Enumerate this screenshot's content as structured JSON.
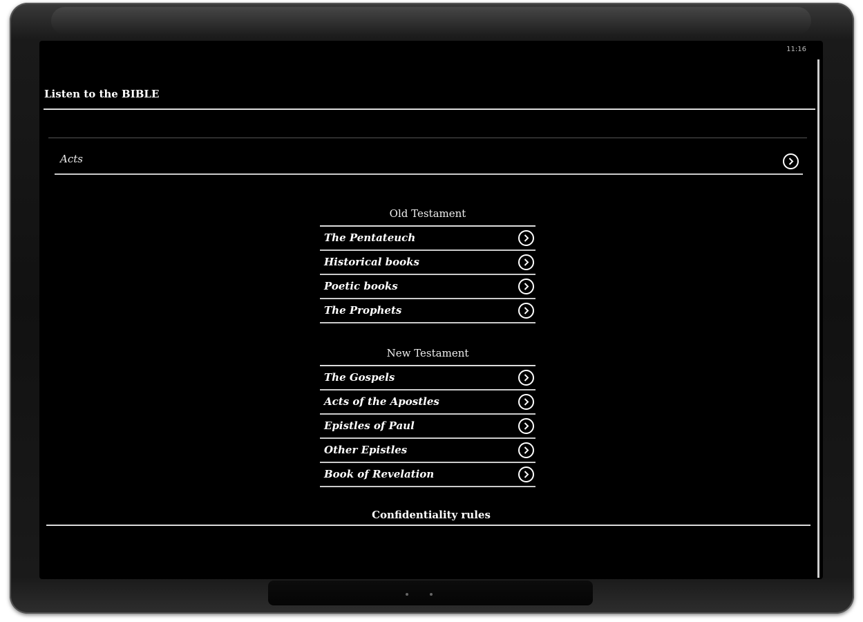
{
  "status_bar": {
    "time": "11:16"
  },
  "app": {
    "title": "Listen to the BIBLE"
  },
  "current": {
    "label": "Acts"
  },
  "old_testament": {
    "title": "Old Testament",
    "items": [
      "The Pentateuch",
      "Historical books",
      "Poetic books",
      "The Prophets"
    ]
  },
  "new_testament": {
    "title": "New Testament",
    "items": [
      "The Gospels",
      "Acts of the Apostles",
      "Epistles of Paul",
      "Other Epistles",
      "Book of Revelation"
    ]
  },
  "footer": {
    "link": "Confidentiality rules"
  },
  "icons": {
    "row_action": "chevron-right-circle-icon"
  },
  "colors": {
    "background": "#000000",
    "text": "#ffffff",
    "divider": "#dddddd",
    "device_frame": "#1a1a1a"
  }
}
